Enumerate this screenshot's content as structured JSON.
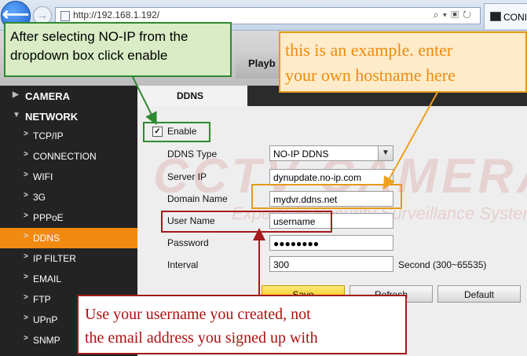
{
  "browser": {
    "url": "http://192.168.1.192/",
    "tab_label": "CONI"
  },
  "top_tab": {
    "playback": "Playb"
  },
  "sidebar": {
    "camera": "CAMERA",
    "network": "NETWORK",
    "items": [
      {
        "label": "TCP/IP"
      },
      {
        "label": "CONNECTION"
      },
      {
        "label": "WIFI"
      },
      {
        "label": "3G"
      },
      {
        "label": "PPPoE"
      },
      {
        "label": "DDNS"
      },
      {
        "label": "IP FILTER"
      },
      {
        "label": "EMAIL"
      },
      {
        "label": "FTP"
      },
      {
        "label": "UPnP"
      },
      {
        "label": "SNMP"
      }
    ],
    "active_item": "DDNS"
  },
  "ddns": {
    "section_title": "DDNS",
    "enable_label": "Enable",
    "enable_checked": true,
    "ddns_type_label": "DDNS Type",
    "ddns_type_value": "NO-IP DDNS",
    "server_ip_label": "Server IP",
    "server_ip_value": "dynupdate.no-ip.com",
    "domain_name_label": "Domain Name",
    "domain_name_value": "mydvr.ddns.net",
    "user_name_label": "User Name",
    "user_name_value": "username",
    "password_label": "Password",
    "password_value": "●●●●●●●●",
    "interval_label": "Interval",
    "interval_value": "300",
    "interval_hint": "Second (300~65535)",
    "save": "Save",
    "refresh": "Refresh",
    "default": "Default"
  },
  "watermark": {
    "main": "CCTV CAMERA WORLD",
    "sub": "Experts in Security Surveillance Systems"
  },
  "annotations": {
    "green": [
      "After selecting NO-IP from the",
      "dropdown box click enable"
    ],
    "orange": [
      "this is an example. enter",
      "your own hostname here"
    ],
    "red": [
      "Use your username you created, not",
      "the email address you signed up with"
    ]
  },
  "colors": {
    "accent_orange": "#f18a10",
    "annotation_green": "#2f8a2f",
    "annotation_orange": "#e59a1a",
    "annotation_red": "#a51a1a"
  }
}
